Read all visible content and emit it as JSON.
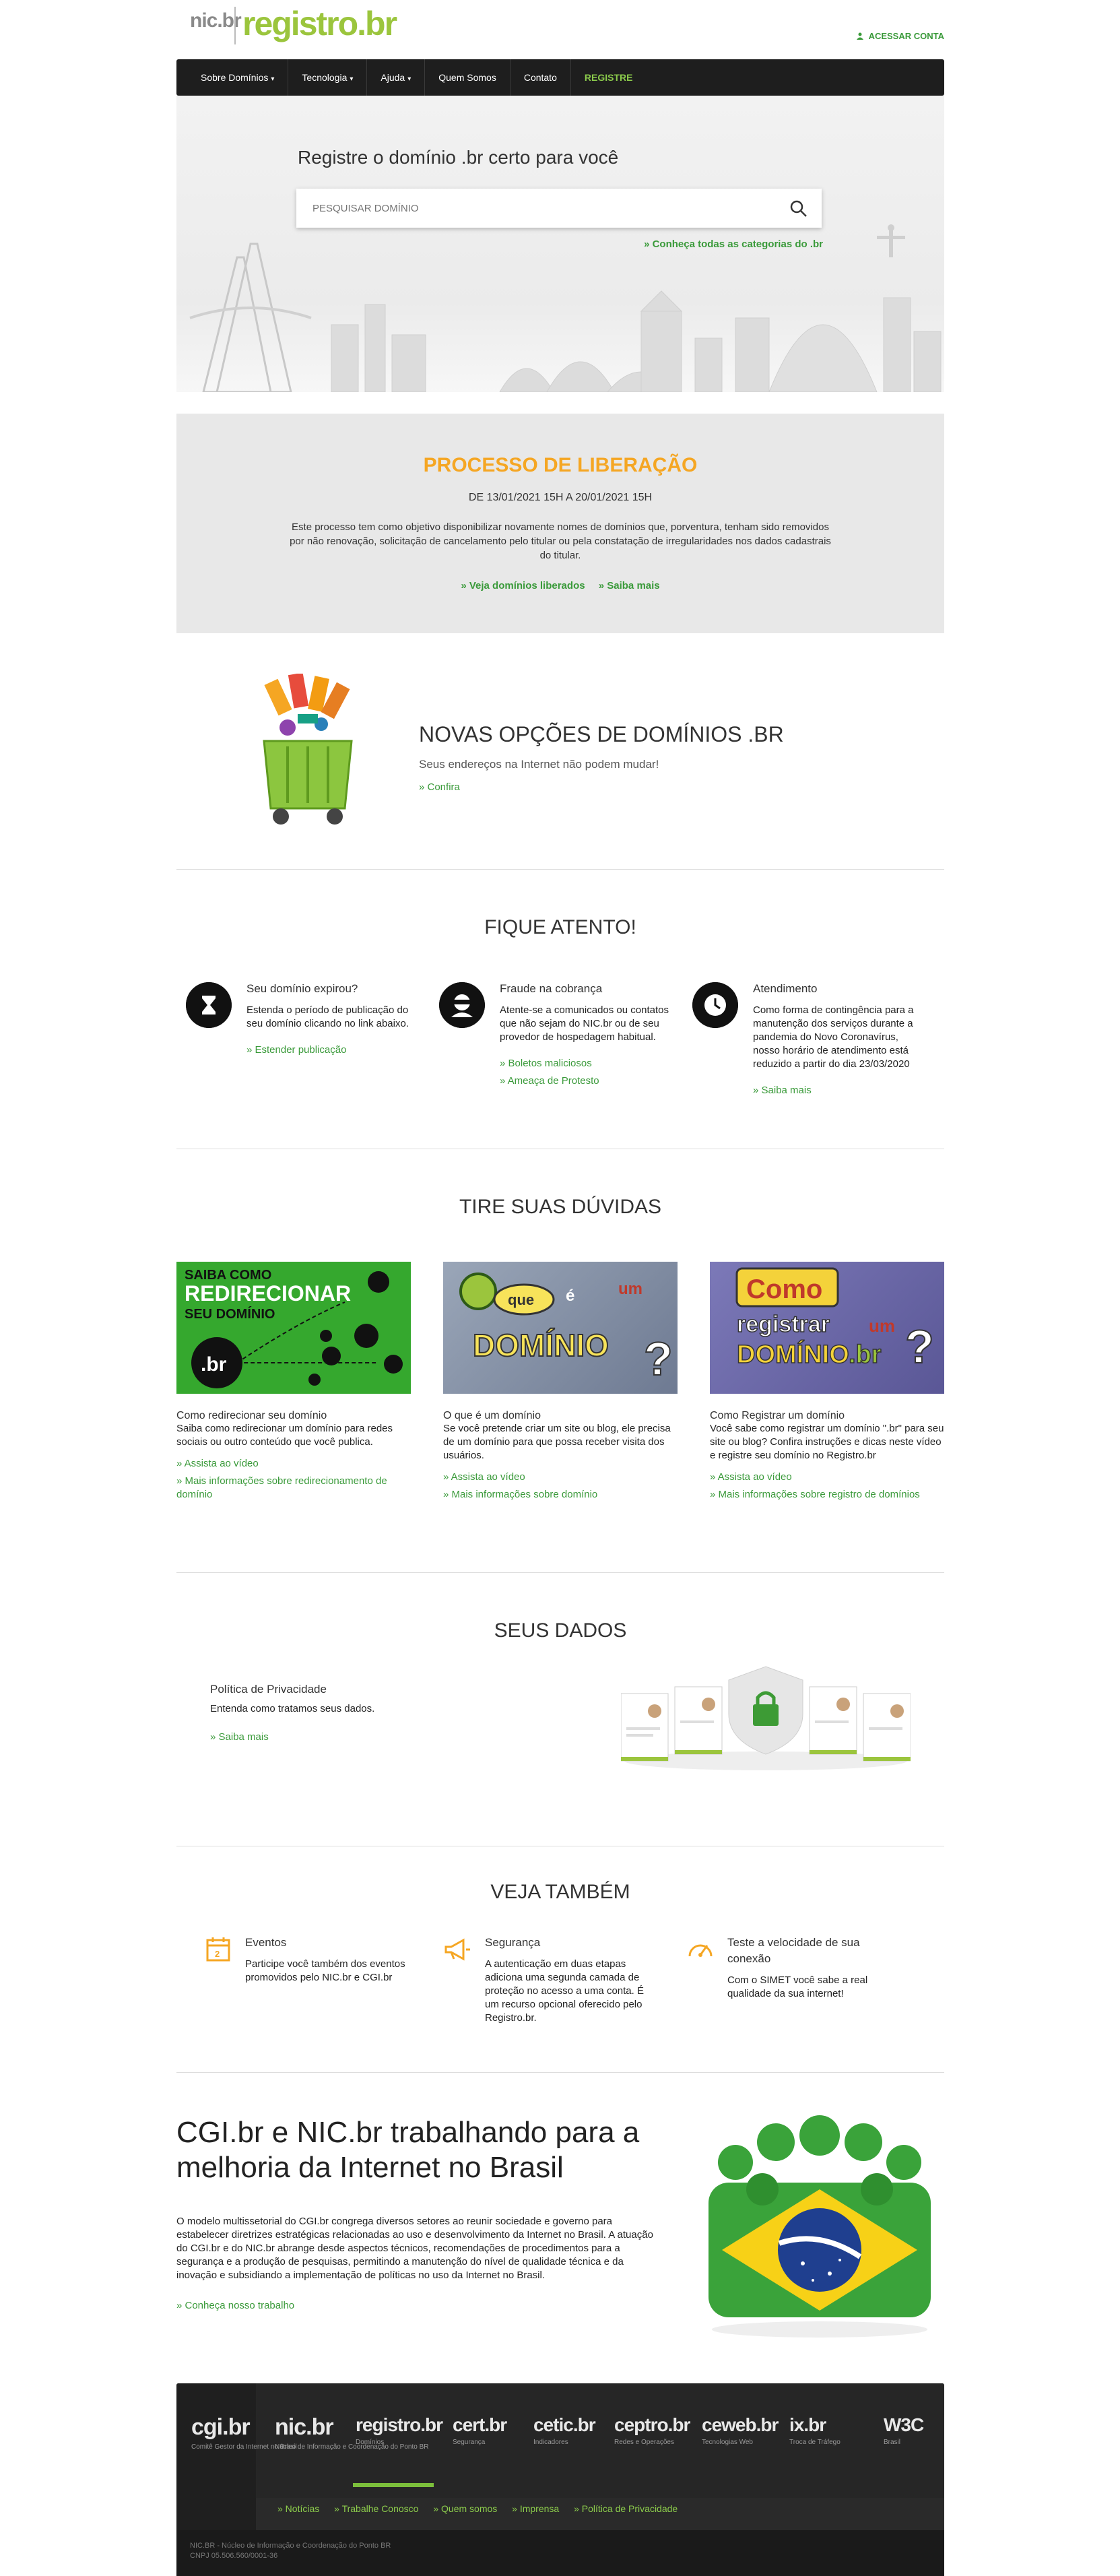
{
  "header": {
    "logo_nic": "nic.br",
    "logo_registro": "registro.br",
    "login_label": "ACESSAR CONTA"
  },
  "nav": {
    "items": [
      {
        "label": "Sobre Domínios",
        "dropdown": true
      },
      {
        "label": "Tecnologia",
        "dropdown": true
      },
      {
        "label": "Ajuda",
        "dropdown": true
      },
      {
        "label": "Quem Somos",
        "dropdown": false
      },
      {
        "label": "Contato",
        "dropdown": false
      },
      {
        "label": "REGISTRE",
        "dropdown": false
      }
    ]
  },
  "hero": {
    "title": "Registre o domínio .br certo para você",
    "search_placeholder": "PESQUISAR DOMÍNIO",
    "categories_link": "» Conheça todas as categorias do .br"
  },
  "liberacao": {
    "title": "PROCESSO DE LIBERAÇÃO",
    "date": "DE 13/01/2021 15H A 20/01/2021 15H",
    "text": "Este processo tem como objetivo disponibilizar novamente nomes de domínios que, porventura, tenham sido removidos por não renovação, solicitação de cancelamento pelo titular ou pela constatação de irregularidades nos dados cadastrais do titular.",
    "link1": "» Veja domínios liberados",
    "link2": "» Saiba mais"
  },
  "novas": {
    "title": "NOVAS OPÇÕES DE DOMÍNIOS .BR",
    "subtitle": "Seus endereços na Internet não podem mudar!",
    "link": "» Confira"
  },
  "atento": {
    "title": "FIQUE ATENTO!",
    "items": [
      {
        "icon": "hourglass-icon",
        "head": "Seu domínio expirou?",
        "text": "Estenda o período de publicação do seu domínio clicando no link abaixo.",
        "links": [
          "» Estender publicação"
        ]
      },
      {
        "icon": "hacker-icon",
        "head": "Fraude na cobrança",
        "text": "Atente-se a comunicados ou contatos que não sejam do NIC.br ou de seu provedor de hospedagem habitual.",
        "links": [
          "» Boletos maliciosos",
          "» Ameaça de Protesto"
        ]
      },
      {
        "icon": "clock-icon",
        "head": "Atendimento",
        "text": "Como forma de contingência para a manutenção dos serviços durante a pandemia do Novo Coronavírus, nosso horário de atendimento está reduzido a partir do dia 23/03/2020",
        "links": [
          "» Saiba mais"
        ]
      }
    ]
  },
  "duvidas": {
    "title": "TIRE SUAS DÚVIDAS",
    "videos": [
      {
        "thumb_text": [
          "SAIBA COMO",
          "REDIRECIONAR",
          "SEU DOMÍNIO",
          ".br"
        ],
        "title": "Como redirecionar seu domínio",
        "text": "Saiba como redirecionar um domínio para redes sociais ou outro conteúdo que você publica.",
        "link1": "» Assista ao vídeo",
        "link2": "» Mais informações sobre redirecionamento de domínio"
      },
      {
        "thumb_text": [
          "que",
          "é",
          "um",
          "DOMÍNIO",
          "?"
        ],
        "title": "O que é um domínio",
        "text": "Se você pretende criar um site ou blog, ele precisa de um domínio para que possa receber visita dos usuários.",
        "link1": "» Assista ao vídeo",
        "link2": "» Mais informações sobre domínio"
      },
      {
        "thumb_text": [
          "Como",
          "registrar",
          "um",
          "DOMÍNIO",
          ".br",
          "?"
        ],
        "title": "Como Registrar um domínio",
        "text": "Você sabe como registrar um domínio \".br\" para seu site ou blog? Confira instruções e dicas neste vídeo e registre seu domínio no Registro.br",
        "link1": "» Assista ao vídeo",
        "link2": "» Mais informações sobre registro de domínios"
      }
    ]
  },
  "dados": {
    "title": "SEUS DADOS",
    "head": "Política de Privacidade",
    "text": "Entenda como tratamos seus dados.",
    "link": "» Saiba mais"
  },
  "veja": {
    "title": "VEJA TAMBÉM",
    "items": [
      {
        "icon": "calendar-icon",
        "head": "Eventos",
        "text": "Participe você também dos eventos promovidos pelo NIC.br e CGI.br"
      },
      {
        "icon": "megaphone-icon",
        "head": "Segurança",
        "text": "A autenticação em duas etapas adiciona uma segunda camada de proteção no acesso a uma conta. É um recurso opcional oferecido pelo Registro.br."
      },
      {
        "icon": "speedometer-icon",
        "head": "Teste a velocidade de sua conexão",
        "text": "Com o SIMET você sabe a real qualidade da sua internet!"
      }
    ]
  },
  "cgi": {
    "title": "CGI.br e NIC.br trabalhando para a melhoria da Internet no Brasil",
    "text": "O modelo multissetorial do CGI.br congrega diversos setores ao reunir sociedade e governo para estabelecer diretrizes estratégicas relacionadas ao uso e desenvolvimento da Internet no Brasil. A atuação do CGI.br e do NIC.br abrange desde aspectos técnicos, recomendações de procedimentos para a segurança e a produção de pesquisas, permitindo a manutenção do nível de qualidade técnica e da inovação e subsidiando a implementação de políticas no uso da Internet no Brasil.",
    "link": "» Conheça nosso trabalho"
  },
  "footer": {
    "logos": [
      {
        "name": "cgi.br",
        "sub": "Comitê Gestor da Internet no Brasil"
      },
      {
        "name": "nic.br",
        "sub": "Núcleo de Informação e Coordenação do Ponto BR"
      },
      {
        "name": "registro.br",
        "sub": "Domínios"
      },
      {
        "name": "cert.br",
        "sub": "Segurança"
      },
      {
        "name": "cetic.br",
        "sub": "Indicadores"
      },
      {
        "name": "ceptro.br",
        "sub": "Redes e Operações"
      },
      {
        "name": "ceweb.br",
        "sub": "Tecnologias Web"
      },
      {
        "name": "ix.br",
        "sub": "Troca de Tráfego"
      },
      {
        "name": "W3C",
        "sub": "Brasil"
      }
    ],
    "links": [
      "» Notícias",
      "» Trabalhe Conosco",
      "» Quem somos",
      "» Imprensa",
      "» Política de Privacidade"
    ],
    "copy1": "NIC.BR - Núcleo de Informação e Coordenação do Ponto BR",
    "copy2": "CNPJ 05.506.560/0001-36"
  },
  "colors": {
    "accent_green": "#3a9a3a",
    "logo_green": "#9bc53d",
    "orange": "#f5a623",
    "nav_bg": "#1e1e1e"
  }
}
